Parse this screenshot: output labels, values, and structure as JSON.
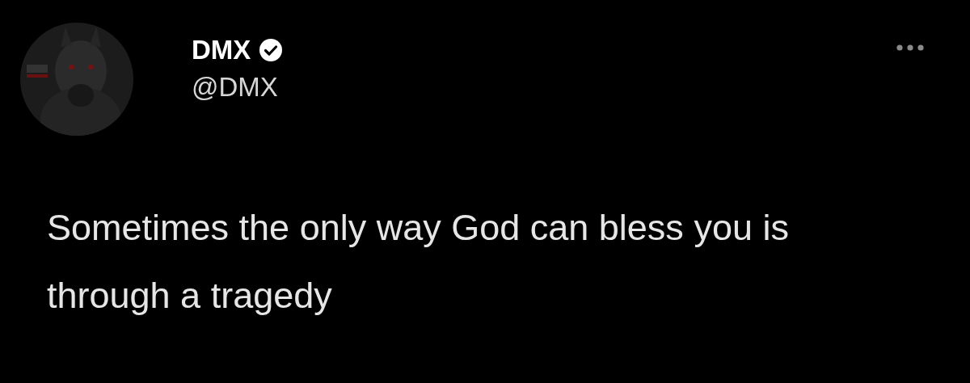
{
  "tweet": {
    "author": {
      "name": "DMX",
      "verified": true,
      "handle": "@DMX"
    },
    "text": "Sometimes the only way God can bless you is through a tragedy"
  }
}
